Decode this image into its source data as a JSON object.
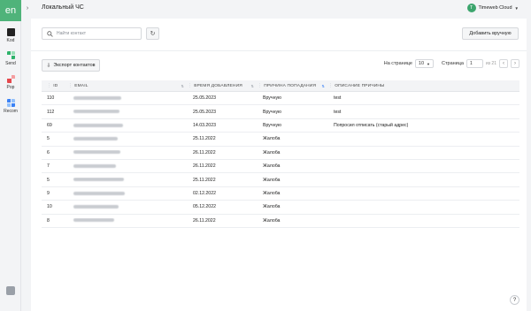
{
  "app": {
    "logo_text": "en",
    "brand_color": "#4fb37a"
  },
  "sidebar": {
    "items": [
      {
        "label": "Kod",
        "icon": "code-block-icon",
        "color": "#222222"
      },
      {
        "label": "Send",
        "icon": "send-icon",
        "color": "#2fb36b"
      },
      {
        "label": "Pop",
        "icon": "popup-icon",
        "color": "#e5484d"
      },
      {
        "label": "Recom",
        "icon": "recommend-icon",
        "color": "#3b82f6"
      }
    ]
  },
  "header": {
    "title": "Локальный ЧС",
    "account_initial": "T",
    "account_name": "Timeweb Cloud"
  },
  "toolbar": {
    "search_placeholder": "Найти контакт",
    "add_label": "Добавить вручную"
  },
  "actions": {
    "export_label": "Экспорт контактов"
  },
  "pagination": {
    "per_page_label": "На странице",
    "per_page_value": "10",
    "page_label": "Страница",
    "page_value": "1",
    "of_label": "из 21"
  },
  "table": {
    "columns": [
      "ID",
      "EMAIL",
      "ВРЕМЯ ДОБАВЛЕНИЯ",
      "ПРИЧИНА ПОПАДАНИЯ",
      "ОПИСАНИЕ ПРИЧИНЫ"
    ],
    "rows": [
      {
        "id": "110",
        "date": "25.05.2023",
        "reason": "Вручную",
        "desc": "test"
      },
      {
        "id": "112",
        "date": "25.05.2023",
        "reason": "Вручную",
        "desc": "test"
      },
      {
        "id": "69",
        "date": "14.03.2023",
        "reason": "Вручную",
        "desc": "Попросил отписать (старый адрес)"
      },
      {
        "id": "5",
        "date": "25.11.2022",
        "reason": "Жалоба",
        "desc": ""
      },
      {
        "id": "6",
        "date": "26.11.2022",
        "reason": "Жалоба",
        "desc": ""
      },
      {
        "id": "7",
        "date": "26.11.2022",
        "reason": "Жалоба",
        "desc": ""
      },
      {
        "id": "5",
        "date": "25.11.2022",
        "reason": "Жалоба",
        "desc": ""
      },
      {
        "id": "9",
        "date": "02.12.2022",
        "reason": "Жалоба",
        "desc": ""
      },
      {
        "id": "10",
        "date": "05.12.2022",
        "reason": "Жалоба",
        "desc": ""
      },
      {
        "id": "8",
        "date": "26.11.2022",
        "reason": "Жалоба",
        "desc": ""
      }
    ]
  },
  "help": {
    "label": "?"
  }
}
